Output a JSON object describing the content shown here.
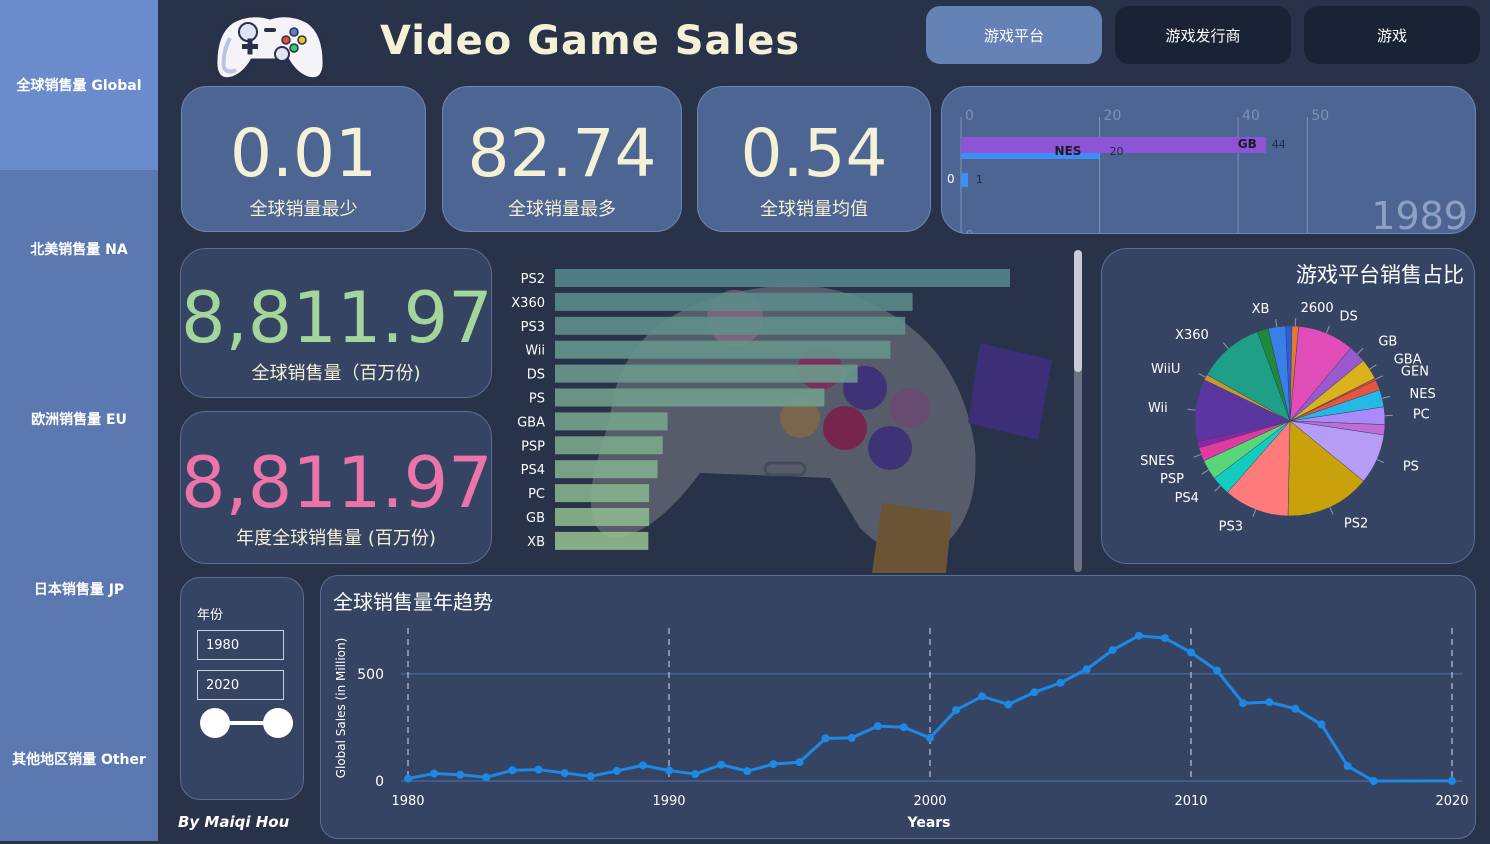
{
  "sidebar": {
    "items": [
      {
        "label": "全球销售量 Global"
      },
      {
        "label": "北美销售量 NA"
      },
      {
        "label": "欧洲销售量 EU"
      },
      {
        "label": "日本销售量 JP"
      },
      {
        "label": "其他地区销量 Other"
      }
    ]
  },
  "header": {
    "title": "Video Game Sales",
    "tabs": [
      {
        "label": "游戏平台"
      },
      {
        "label": "游戏发行商"
      },
      {
        "label": "游戏"
      }
    ]
  },
  "kpis": {
    "min": {
      "value": "0.01",
      "label": "全球销量最少"
    },
    "max": {
      "value": "82.74",
      "label": "全球销量最多"
    },
    "avg": {
      "value": "0.54",
      "label": "全球销量均值"
    },
    "total": {
      "value": "8,811.97",
      "label": "全球销售量（百万份)"
    },
    "yearly": {
      "value": "8,811.97",
      "label": "年度全球销售量 (百万份)"
    }
  },
  "filter": {
    "label": "年份",
    "start": "1980",
    "end": "2020"
  },
  "author": "By Maiqi Hou",
  "colors": {
    "total_green": "#a4d59a",
    "yearly_pink": "#ec74aa",
    "line_blue": "#1e88e5",
    "bar_teal": "#7fb5a5"
  },
  "chart_data": [
    {
      "type": "bar",
      "name": "race",
      "year_label": "1989",
      "x_ticks": [
        "0",
        "20",
        "40",
        "50"
      ],
      "xlim": [
        0,
        55
      ],
      "rows": [
        {
          "label": "GB",
          "value": 44,
          "value_label": "44",
          "color": "#8e54d6"
        },
        {
          "label": "NES",
          "value": 20,
          "value_label": "20",
          "color": "#3e8ef7"
        },
        {
          "label": "0",
          "value": 1,
          "value_label": "1",
          "color": "#3e8ef7"
        }
      ],
      "trailing_tick": "0"
    },
    {
      "type": "bar",
      "name": "platform_bars",
      "categories": [
        "PS2",
        "X360",
        "PS3",
        "Wii",
        "DS",
        "PS",
        "GBA",
        "PSP",
        "PS4",
        "PC",
        "GB",
        "XB"
      ],
      "values": [
        1233,
        969,
        949,
        909,
        820,
        730,
        305,
        292,
        278,
        255,
        255,
        253
      ]
    },
    {
      "type": "pie",
      "title": "游戏平台销售占比",
      "slices": [
        {
          "label": "2600",
          "value": 97,
          "color": "#e8762f"
        },
        {
          "label": "DS",
          "value": 820,
          "color": "#e04db8"
        },
        {
          "label": "GB",
          "value": 255,
          "color": "#9b59d0"
        },
        {
          "label": "GBA",
          "value": 305,
          "color": "#d9b21c"
        },
        {
          "label": "GEN",
          "value": 28,
          "color": "#e14a3b"
        },
        {
          "label": "",
          "value": 150,
          "color": "#e8553d"
        },
        {
          "label": "NES",
          "value": 251,
          "color": "#27b7e6"
        },
        {
          "label": "PC",
          "value": 255,
          "color": "#a78bfa"
        },
        {
          "label": "",
          "value": 150,
          "color": "#c06bd6"
        },
        {
          "label": "PS",
          "value": 730,
          "color": "#b79cf5"
        },
        {
          "label": "PS2",
          "value": 1233,
          "color": "#c9a20b"
        },
        {
          "label": "PS3",
          "value": 949,
          "color": "#ff7a7a"
        },
        {
          "label": "PS4",
          "value": 278,
          "color": "#14cbbf"
        },
        {
          "label": "PSP",
          "value": 292,
          "color": "#5ad67a"
        },
        {
          "label": "SNES",
          "value": 200,
          "color": "#e03ca0"
        },
        {
          "label": "",
          "value": 90,
          "color": "#8e24aa"
        },
        {
          "label": "Wii",
          "value": 909,
          "color": "#5b36a0"
        },
        {
          "label": "WiiU",
          "value": 82,
          "color": "#c9982a"
        },
        {
          "label": "X360",
          "value": 969,
          "color": "#1f9e88"
        },
        {
          "label": "",
          "value": 160,
          "color": "#1d8a3a"
        },
        {
          "label": "XB",
          "value": 253,
          "color": "#3a7ee8"
        },
        {
          "label": "",
          "value": 90,
          "color": "#2b5fd6"
        }
      ]
    },
    {
      "type": "line",
      "title": "全球销售量年趋势",
      "xlabel": "Years",
      "ylabel": "Global Sales (in Million)",
      "xlim": [
        1980,
        2020
      ],
      "ylim": [
        0,
        700
      ],
      "x_ticks": [
        1980,
        1990,
        2000,
        2010,
        2020
      ],
      "y_ticks": [
        0,
        500
      ],
      "x": [
        1980,
        1981,
        1982,
        1983,
        1984,
        1985,
        1986,
        1987,
        1988,
        1989,
        1990,
        1991,
        1992,
        1993,
        1994,
        1995,
        1996,
        1997,
        1998,
        1999,
        2000,
        2001,
        2002,
        2003,
        2004,
        2005,
        2006,
        2007,
        2008,
        2009,
        2010,
        2011,
        2012,
        2013,
        2014,
        2015,
        2016,
        2017,
        2020
      ],
      "y": [
        11,
        35,
        29,
        17,
        50,
        53,
        37,
        22,
        47,
        73,
        49,
        32,
        76,
        46,
        79,
        88,
        199,
        201,
        256,
        251,
        201,
        331,
        395,
        357,
        414,
        458,
        521,
        611,
        678,
        667,
        600,
        515,
        363,
        368,
        337,
        264,
        70,
        0.05,
        0.3
      ]
    }
  ]
}
